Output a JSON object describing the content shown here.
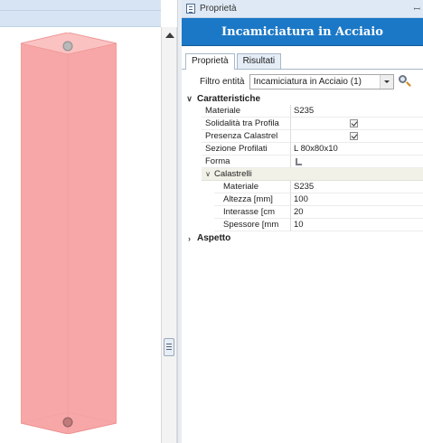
{
  "panel": {
    "title": "Proprietà",
    "pin_glyph": "ꟷ"
  },
  "header": {
    "title": "Incamiciatura in Acciaio"
  },
  "tabs": [
    {
      "label": "Proprietà",
      "active": true
    },
    {
      "label": "Risultati",
      "active": false
    }
  ],
  "filter": {
    "label": "Filtro entità",
    "value": "Incamiciatura in Acciaio (1)"
  },
  "grid": {
    "category_main": {
      "label": "Caratteristiche",
      "expanded": true
    },
    "rows": [
      {
        "name": "Materiale",
        "value": "S235"
      },
      {
        "name": "Solidalità tra Profila",
        "checked": true
      },
      {
        "name": "Presenza Calastrel",
        "checked": true
      },
      {
        "name": "Sezione Profilati",
        "value": "L 80x80x10"
      },
      {
        "name": "Forma",
        "icon": "angle-profile-icon"
      }
    ],
    "sub_category": {
      "label": "Calastrelli",
      "expanded": true
    },
    "sub_rows": [
      {
        "name": "Materiale",
        "value": "S235"
      },
      {
        "name": "Altezza  [mm]",
        "value": "100"
      },
      {
        "name": "Interasse  [cm",
        "value": "20"
      },
      {
        "name": "Spessore  [mm",
        "value": "10"
      }
    ],
    "category_second": {
      "label": "Aspetto",
      "expanded": false
    }
  },
  "colors": {
    "header_bg": "#1b78c6",
    "column_fill": "#f7a7a7",
    "column_edge": "#ee8d8d"
  }
}
